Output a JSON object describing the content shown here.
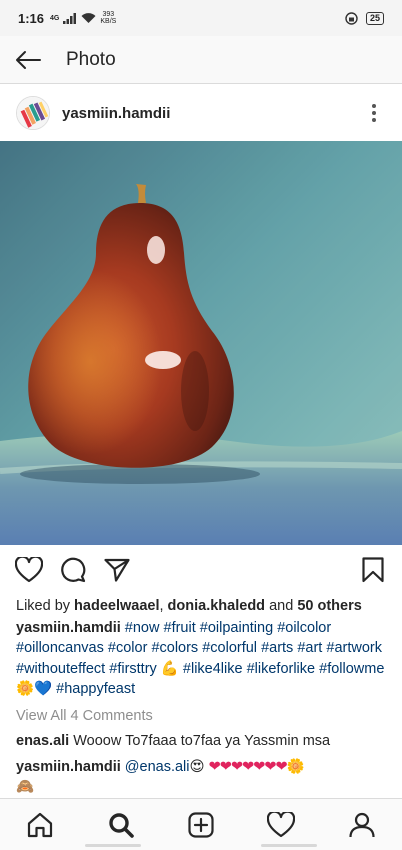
{
  "status_bar": {
    "time": "1:16",
    "network": "4G",
    "speed_value": "393",
    "speed_unit": "KB/S",
    "battery": "25"
  },
  "header": {
    "title": "Photo"
  },
  "post": {
    "username": "yasmiin.hamdii",
    "likes": {
      "prefix": "Liked by",
      "user1": "hadeelwaael",
      "sep": ",",
      "user2": "donia.khaledd",
      "and": "and",
      "others": "50 others"
    },
    "caption": {
      "username": "yasmiin.hamdii",
      "tags": [
        "#now",
        "#fruit",
        "#oilpainting",
        "#oilcolor",
        "#oilloncanvas",
        "#color",
        "#colors",
        "#colorful",
        "#arts",
        "#art",
        "#artwork",
        "#withouteffect",
        "#firsttry"
      ],
      "emoji1": "💪",
      "tags2": [
        "#like4like",
        "#likeforlike",
        "#followme"
      ],
      "emoji2": "🌼💙",
      "tag_last": "#happyfeast"
    },
    "view_comments": "View All 4 Comments",
    "comments": [
      {
        "username": "enas.ali",
        "text": "Wooow To7faaa to7faa ya Yassmin msa"
      },
      {
        "username": "yasmiin.hamdii",
        "mention": "@enas.ali",
        "emoji": "😍",
        "hearts": "❤❤❤❤❤❤❤",
        "flower": "🌼",
        "monkey": "🙈"
      }
    ]
  },
  "colors": {
    "link": "#00376b",
    "muted": "#8e8e8e",
    "text": "#262626"
  }
}
